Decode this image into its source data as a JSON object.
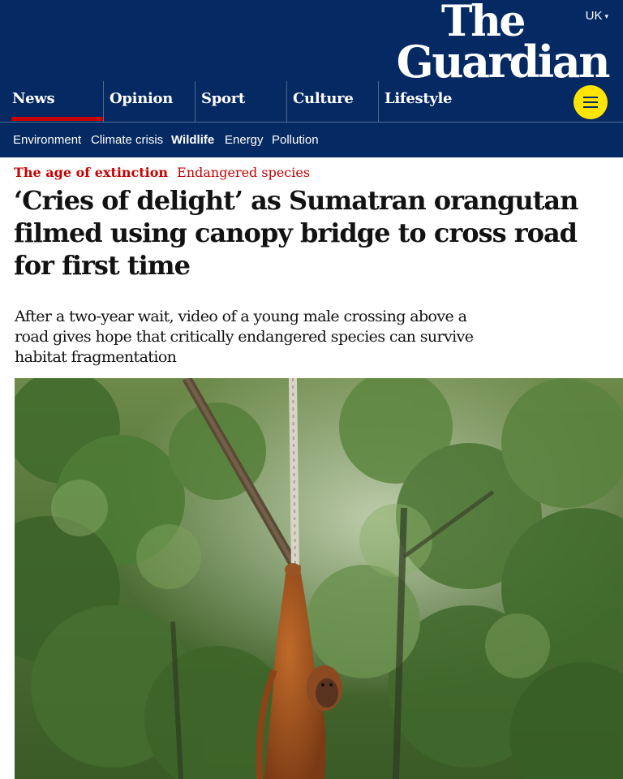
{
  "header": {
    "edition": "UK",
    "logo_line1": "The",
    "logo_line2": "Guardian",
    "pillars": [
      "News",
      "Opinion",
      "Sport",
      "Culture",
      "Lifestyle"
    ],
    "active_pillar": "News",
    "accent_color": "#c70000",
    "brand_color": "#052962",
    "menu_icon": "hamburger-menu-icon"
  },
  "subnav": {
    "items": [
      "Environment",
      "Climate crisis",
      "Wildlife",
      "Energy",
      "Pollution"
    ],
    "active": "Wildlife"
  },
  "article": {
    "series": "The age of extinction",
    "tag": "Endangered species",
    "headline": "‘Cries of delight’ as Sumatran orangutan filmed using canopy bridge to cross road for first time",
    "standfirst": "After a two-year wait, video of a young male crossing above a road gives hope that critically endangered species can survive habitat fragmentation"
  }
}
